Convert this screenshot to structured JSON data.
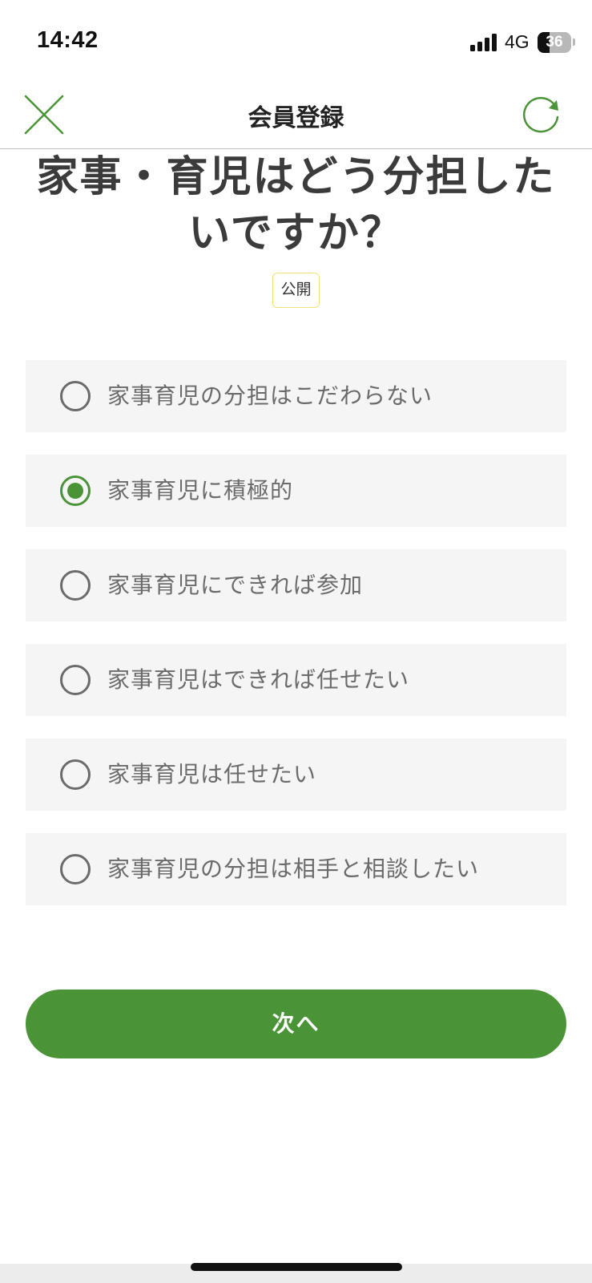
{
  "status_bar": {
    "time": "14:42",
    "network": "4G",
    "battery_level": "36",
    "battery_fraction": 0.36
  },
  "header": {
    "title": "会員登録",
    "close_icon": "close-icon",
    "refresh_icon": "refresh-icon",
    "accent_color": "#4a9437"
  },
  "question": {
    "title": "家事・育児はどう分担したいですか？",
    "badge": "公開"
  },
  "options": [
    {
      "label": "家事育児の分担はこだわらない",
      "selected": false
    },
    {
      "label": "家事育児に積極的",
      "selected": true
    },
    {
      "label": "家事育児にできれば参加",
      "selected": false
    },
    {
      "label": "家事育児はできれば任せたい",
      "selected": false
    },
    {
      "label": "家事育児は任せたい",
      "selected": false
    },
    {
      "label": "家事育児の分担は相手と相談したい",
      "selected": false
    }
  ],
  "next_button": {
    "label": "次へ"
  }
}
